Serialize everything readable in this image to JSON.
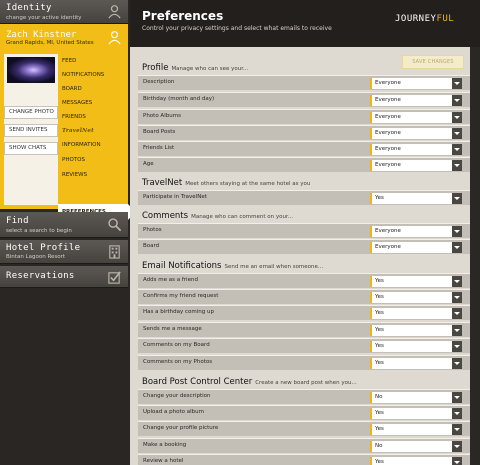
{
  "sidebar": {
    "identity": {
      "title": "Identity",
      "subtitle": "change your active identity"
    },
    "user": {
      "name": "Zach Kinstner",
      "location": "Grand Rapids, MI, United States"
    },
    "buttons": {
      "change_photo": "CHANGE PHOTO",
      "send_invites": "SEND INVITES",
      "show_chats": "SHOW CHATS"
    },
    "nav": [
      "FEED",
      "NOTIFICATIONS",
      "BOARD",
      "MESSAGES",
      "FRIENDS",
      "TravelNet",
      "INFORMATION",
      "PHOTOS",
      "REVIEWS",
      "PREFERENCES"
    ],
    "find": {
      "title": "Find",
      "subtitle": "select a search to begin"
    },
    "hotel": {
      "title": "Hotel Profile",
      "subtitle": "Bintan Lagoon Resort"
    },
    "reservations": {
      "title": "Reservations"
    }
  },
  "header": {
    "title": "Preferences",
    "subtitle": "Control your privacy settings and select what emails to receive",
    "brand_pre": "JOURNEY",
    "brand_post": "FUL"
  },
  "save_label": "SAVE CHANGES",
  "sections": [
    {
      "title": "Profile",
      "description": "Manage who can see your...",
      "rows": [
        {
          "label": "Description",
          "value": "Everyone"
        },
        {
          "label": "Birthday (month and day)",
          "value": "Everyone"
        },
        {
          "label": "Photo Albums",
          "value": "Everyone"
        },
        {
          "label": "Board Posts",
          "value": "Everyone"
        },
        {
          "label": "Friends List",
          "value": "Everyone"
        },
        {
          "label": "Age",
          "value": "Everyone"
        }
      ]
    },
    {
      "title": "TravelNet",
      "description": "Meet others staying at the same hotel as you",
      "rows": [
        {
          "label": "Participate in TravelNet",
          "value": "Yes"
        }
      ]
    },
    {
      "title": "Comments",
      "description": "Manage who can comment on your...",
      "rows": [
        {
          "label": "Photos",
          "value": "Everyone"
        },
        {
          "label": "Board",
          "value": "Everyone"
        }
      ]
    },
    {
      "title": "Email Notifications",
      "description": "Send me an email when someone...",
      "rows": [
        {
          "label": "Adds me as a friend",
          "value": "Yes"
        },
        {
          "label": "Confirms my friend request",
          "value": "Yes"
        },
        {
          "label": "Has a birthday coming up",
          "value": "Yes"
        },
        {
          "label": "Sends me a message",
          "value": "Yes"
        },
        {
          "label": "Comments on my Board",
          "value": "Yes"
        },
        {
          "label": "Comments on my Photos",
          "value": "Yes"
        }
      ]
    },
    {
      "title": "Board Post Control Center",
      "description": "Create a new board post when you...",
      "rows": [
        {
          "label": "Change your description",
          "value": "No"
        },
        {
          "label": "Upload a photo album",
          "value": "Yes"
        },
        {
          "label": "Change your profile picture",
          "value": "Yes"
        },
        {
          "label": "Make a booking",
          "value": "No"
        },
        {
          "label": "Review a hotel",
          "value": "Yes"
        }
      ]
    }
  ]
}
